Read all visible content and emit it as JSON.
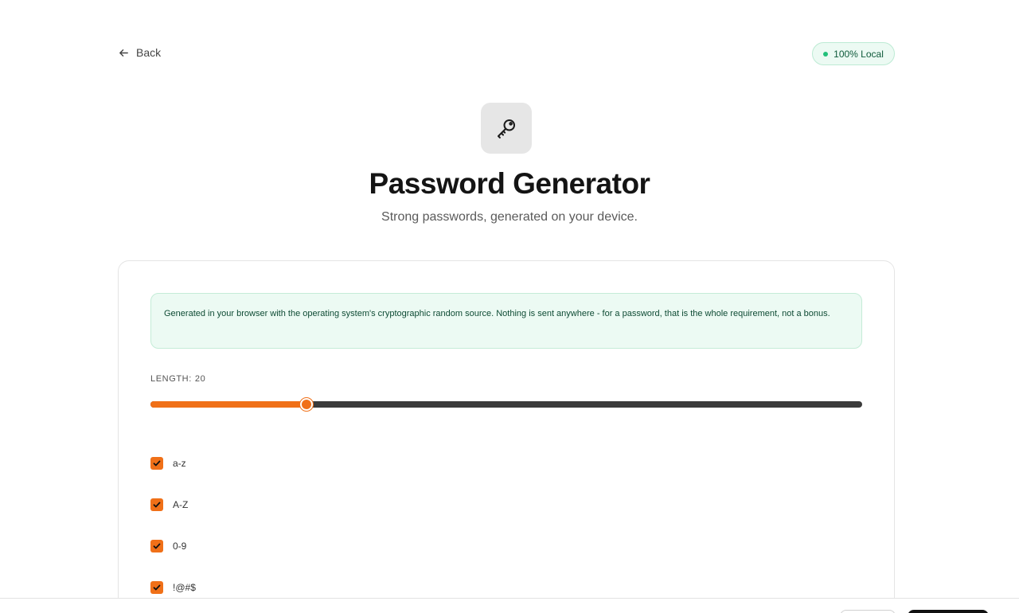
{
  "nav": {
    "back_label": "Back"
  },
  "badge": {
    "label": "100% Local",
    "color": "#22c07a"
  },
  "header": {
    "icon": "key-icon",
    "title": "Password Generator",
    "subtitle": "Strong passwords, generated on your device."
  },
  "card": {
    "notice": "Generated in your browser with the operating system's cryptographic random source. Nothing is sent anywhere - for a password, that is the whole requirement, not a bonus.",
    "length": {
      "label": "LENGTH:",
      "value": "20",
      "fill_fraction": 0.219
    },
    "options": [
      {
        "label": "a-z",
        "checked": true
      },
      {
        "label": "A-Z",
        "checked": true
      },
      {
        "label": "0-9",
        "checked": true
      },
      {
        "label": "!@#$",
        "checked": true
      }
    ]
  },
  "colors": {
    "accent": "#f07018",
    "success": "#22c07a"
  }
}
